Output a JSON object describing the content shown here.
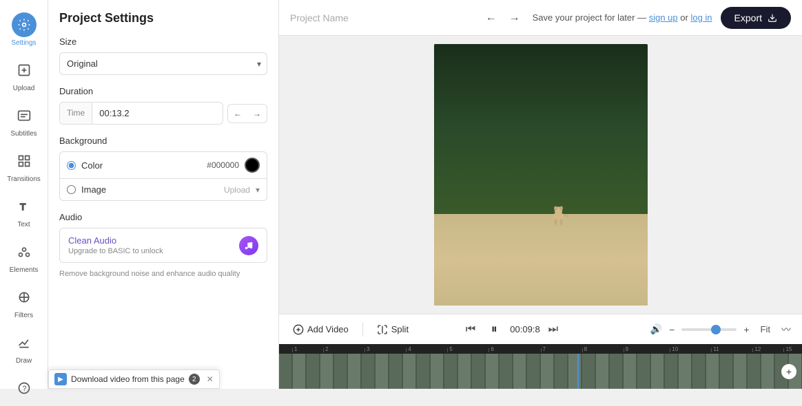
{
  "sidebar": {
    "items": [
      {
        "id": "settings",
        "label": "Settings",
        "active": true
      },
      {
        "id": "upload",
        "label": "Upload",
        "active": false
      },
      {
        "id": "subtitles",
        "label": "Subtitles",
        "active": false
      },
      {
        "id": "transitions",
        "label": "Transitions",
        "active": false
      },
      {
        "id": "text",
        "label": "Text",
        "active": false
      },
      {
        "id": "elements",
        "label": "Elements",
        "active": false
      },
      {
        "id": "filters",
        "label": "Filters",
        "active": false
      },
      {
        "id": "draw",
        "label": "Draw",
        "active": false
      },
      {
        "id": "help",
        "label": "",
        "active": false
      }
    ]
  },
  "settings": {
    "title": "Project Settings",
    "size_section": "Size",
    "size_value": "Original",
    "duration_section": "Duration",
    "duration_type": "Time",
    "duration_value": "00:13.2",
    "background_section": "Background",
    "color_label": "Color",
    "color_value": "#000000",
    "image_label": "Image",
    "image_upload": "Upload",
    "audio_section": "Audio",
    "audio_title": "Clean Audio",
    "audio_subtitle": "Upgrade to BASIC to unlock",
    "bg_noise_text": "Remove background noise and enhance audio quality"
  },
  "topbar": {
    "project_name_placeholder": "Project Name",
    "save_text": "Save your project for later —",
    "sign_up": "sign up",
    "or": "or",
    "log_in": "log in",
    "export_label": "Export"
  },
  "playback": {
    "add_video": "Add Video",
    "split": "Split",
    "timecode": "00:09:8",
    "fit_label": "Fit"
  },
  "download_bar": {
    "text": "Download video from this page",
    "number": "2"
  },
  "zoom": {
    "level": 65
  }
}
